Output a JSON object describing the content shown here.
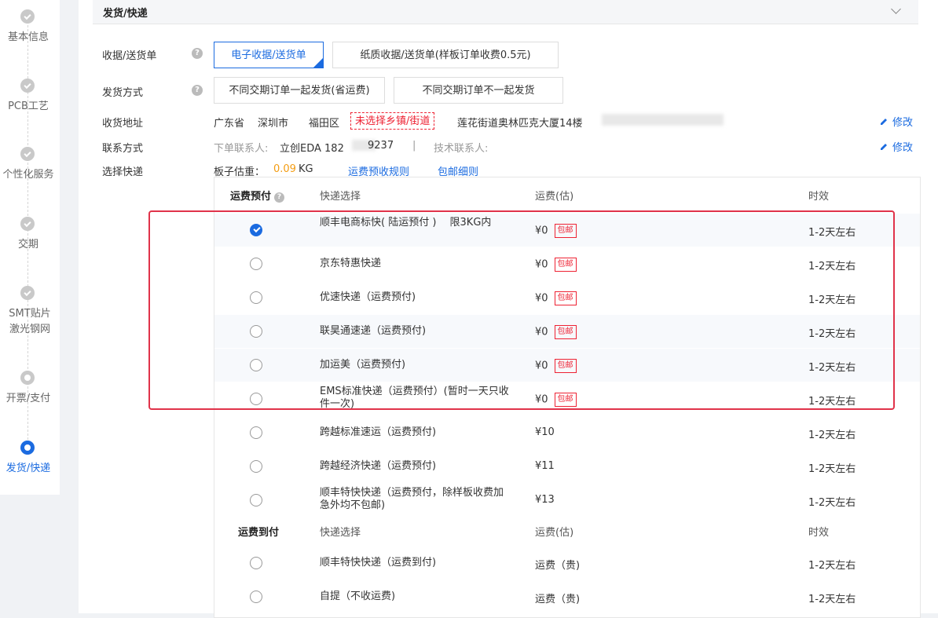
{
  "sidebar": {
    "steps": [
      {
        "label": "基本信息",
        "state": "done"
      },
      {
        "label": "PCB工艺",
        "state": "done"
      },
      {
        "label": "个性化服务",
        "state": "done"
      },
      {
        "label": "交期",
        "state": "done"
      },
      {
        "label": "SMT贴片 激光钢网",
        "state": "done"
      },
      {
        "label": "开票/支付",
        "state": "pending"
      },
      {
        "label": "发货/快递",
        "state": "active"
      }
    ]
  },
  "section": {
    "title": "发货/快递"
  },
  "receipt": {
    "label": "收据/送货单",
    "options": [
      "电子收据/送货单",
      "纸质收据/送货单(样板订单收费0.5元)"
    ],
    "selected": 0
  },
  "ship_method": {
    "label": "发货方式",
    "options": [
      "不同交期订单一起发货(省运费)",
      "不同交期订单不一起发货"
    ]
  },
  "address": {
    "label": "收货地址",
    "province": "广东省",
    "city": "深圳市",
    "district": "福田区",
    "street_warning": "未选择乡镇/街道",
    "detail": "莲花街道奥林匹克大厦14楼",
    "edit_label": "修改"
  },
  "contact": {
    "label": "联系方式",
    "order_contact_prefix": "下单联系人:",
    "order_contact": "立创EDA 182",
    "order_contact_tail": "9237",
    "separator": "|",
    "tech_contact": "技术联系人:",
    "edit_label": "修改"
  },
  "express": {
    "label": "选择快递",
    "weight_prefix": "板子估重：",
    "weight_value": "0.09",
    "weight_unit": "KG",
    "link_rules": "运费预收规则",
    "link_free": "包邮细则"
  },
  "prepaid_table": {
    "title": "运费预付",
    "col_select": "快递选择",
    "col_fee": "运费(估)",
    "col_time": "时效",
    "rows": [
      {
        "name": "顺丰电商标快( 陆运预付 )　 限3KG内",
        "fee": "¥0",
        "badge": "包邮",
        "time": "1-2天左右",
        "selected": true
      },
      {
        "name": "京东特惠快递",
        "fee": "¥0",
        "badge": "包邮",
        "time": "1-2天左右",
        "selected": false
      },
      {
        "name": "优速快递（运费预付)",
        "fee": "¥0",
        "badge": "包邮",
        "time": "1-2天左右",
        "selected": false
      },
      {
        "name": "联昊通速递（运费预付)",
        "fee": "¥0",
        "badge": "包邮",
        "time": "1-2天左右",
        "selected": false
      },
      {
        "name": "加运美（运费预付)",
        "fee": "¥0",
        "badge": "包邮",
        "time": "1-2天左右",
        "selected": false
      },
      {
        "name": "EMS标准快递（运费预付）(暂时一天只收件一次)",
        "fee": "¥0",
        "badge": "包邮",
        "time": "1-2天左右",
        "selected": false
      },
      {
        "name": "跨越标准速运（运费预付)",
        "fee": "¥10",
        "badge": "",
        "time": "1-2天左右",
        "selected": false
      },
      {
        "name": "跨越经济快递（运费预付)",
        "fee": "¥11",
        "badge": "",
        "time": "1-2天左右",
        "selected": false
      },
      {
        "name": "顺丰特快快递（运费预付，除样板收费加急外均不包邮)",
        "fee": "¥13",
        "badge": "",
        "time": "1-2天左右",
        "selected": false
      }
    ]
  },
  "cod_table": {
    "title": "运费到付",
    "col_select": "快递选择",
    "col_fee": "运费(估)",
    "col_time": "时效",
    "rows": [
      {
        "name": "顺丰特快快递（运费到付)",
        "fee": "运费（贵)",
        "time": "1-2天左右"
      },
      {
        "name": "自提（不收运费)",
        "fee": "运费（贵)",
        "time": "1-2天左右"
      }
    ]
  },
  "colors": {
    "accent": "#1b6be0",
    "warning": "#e23333",
    "highlight_box": "#e0334a",
    "weight": "#f39c12"
  }
}
